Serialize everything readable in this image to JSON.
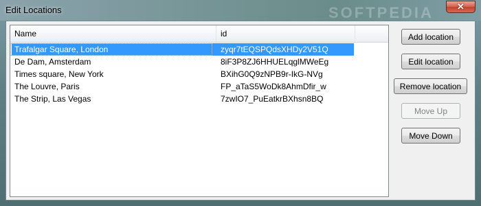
{
  "window": {
    "title": "Edit Locations",
    "watermark": "SOFTPEDIA",
    "close_glyph": "✕"
  },
  "list": {
    "columns": [
      "Name",
      "id"
    ],
    "rows": [
      {
        "name": "Trafalgar Square, London",
        "id": "zyqr7tEQSPQdsXHDy2V51Q",
        "selected": true
      },
      {
        "name": "De Dam, Amsterdam",
        "id": "8iF3P8ZJ6HHUELqglMWeEg",
        "selected": false
      },
      {
        "name": "Times square, New York",
        "id": "BXihG0Q9zNPB9r-IkG-NVg",
        "selected": false
      },
      {
        "name": "The Louvre, Paris",
        "id": "FP_aTaS5WoDk8AhmDfir_w",
        "selected": false
      },
      {
        "name": "The Strip, Las Vegas",
        "id": "7zwIO7_PuEatkrBXhsn8BQ",
        "selected": false
      }
    ]
  },
  "buttons": {
    "add": "Add location",
    "edit": "Edit location",
    "remove": "Remove location",
    "move_up": "Move Up",
    "move_down": "Move Down"
  },
  "colors": {
    "selection": "#3399ff",
    "window_bg": "#f0f0f0",
    "close_button": "#c2422d"
  }
}
